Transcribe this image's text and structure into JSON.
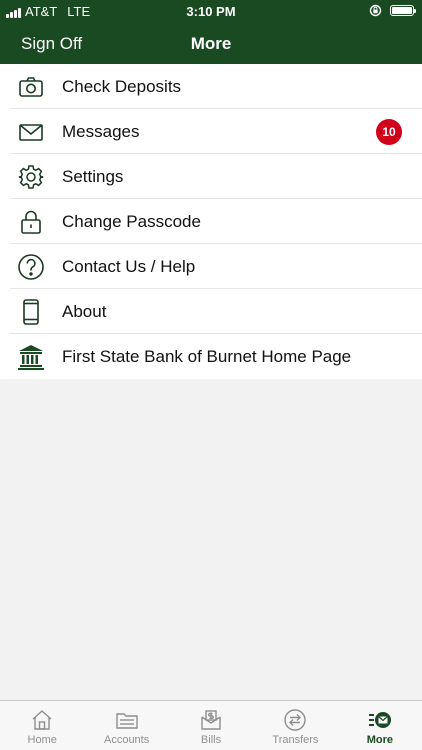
{
  "status_bar": {
    "carrier": "AT&T",
    "network": "LTE",
    "time": "3:10 PM"
  },
  "nav": {
    "left_button": "Sign Off",
    "title": "More"
  },
  "menu": {
    "items": [
      {
        "label": "Check Deposits",
        "icon": "camera-icon"
      },
      {
        "label": "Messages",
        "icon": "envelope-icon",
        "badge": "10"
      },
      {
        "label": "Settings",
        "icon": "gear-icon"
      },
      {
        "label": "Change Passcode",
        "icon": "lock-icon"
      },
      {
        "label": "Contact Us / Help",
        "icon": "question-icon"
      },
      {
        "label": "About",
        "icon": "phone-icon"
      },
      {
        "label": "First State Bank of Burnet Home Page",
        "icon": "bank-icon"
      }
    ]
  },
  "tabs": [
    {
      "label": "Home",
      "icon": "home-icon"
    },
    {
      "label": "Accounts",
      "icon": "accounts-icon"
    },
    {
      "label": "Bills",
      "icon": "bills-icon"
    },
    {
      "label": "Transfers",
      "icon": "transfers-icon"
    },
    {
      "label": "More",
      "icon": "more-icon",
      "active": true
    }
  ],
  "colors": {
    "brand_green": "#1a4a22",
    "badge_red": "#d0021b",
    "inactive_tab": "#8e8e8e"
  }
}
